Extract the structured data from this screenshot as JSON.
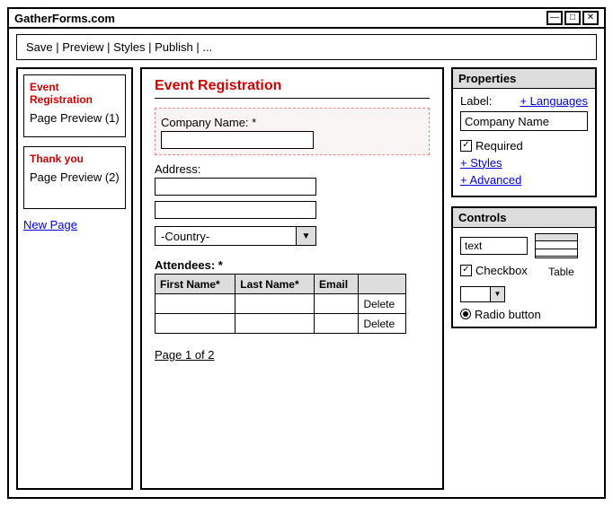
{
  "window": {
    "title": "GatherForms.com"
  },
  "toolbar": {
    "save": "Save",
    "preview": "Preview",
    "styles": "Styles",
    "publish": "Publish",
    "more": "..."
  },
  "sidebar": {
    "pages": [
      {
        "title": "Event Registration",
        "preview": "Page Preview (1)"
      },
      {
        "title": "Thank you",
        "preview": "Page Preview (2)"
      }
    ],
    "new_page": "New Page"
  },
  "form": {
    "title": "Event Registration",
    "company_label": "Company Name: *",
    "address_label": "Address:",
    "country_placeholder": "-Country-",
    "attendees_label": "Attendees: *",
    "columns": {
      "first": "First Name*",
      "last": "Last Name*",
      "email": "Email"
    },
    "delete": "Delete",
    "page_indicator": "Page 1 of 2"
  },
  "properties": {
    "header": "Properties",
    "label_text": "Label:",
    "languages": "+ Languages",
    "label_value": "Company Name",
    "required": "Required",
    "styles": "+ Styles",
    "advanced": "+ Advanced"
  },
  "controls": {
    "header": "Controls",
    "text": "text",
    "checkbox": "Checkbox",
    "table": "Table",
    "radio": "Radio button"
  }
}
